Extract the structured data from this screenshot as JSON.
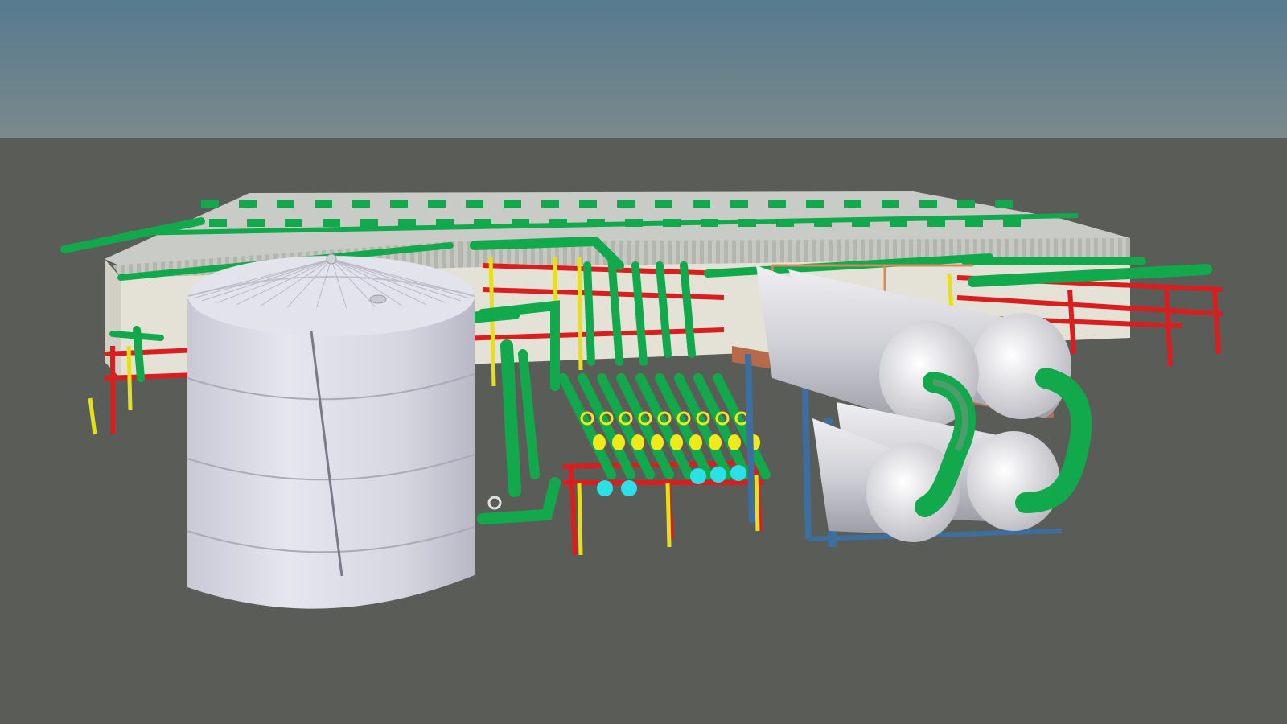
{
  "viewport": {
    "type": "3d-plant-model",
    "colors": {
      "sky_top": "#577a8e",
      "sky_bottom": "#7a898b",
      "ground": "#5a5d57",
      "building_roof": "#c9cbc6",
      "building_wall": "#e4e2d6",
      "steel_structure": "#d81e1e",
      "steel_support": "#e6e01c",
      "pipe": "#12a84c",
      "pipe_light": "#3fd27a",
      "valve": "#f0ea1a",
      "valve_cyan": "#2ce0e8",
      "tank": "#d9d9e3",
      "vessel": "#d3d3d8",
      "frame_blue": "#3c6fa0",
      "frame_brown": "#b56a4a"
    },
    "objects": {
      "tank": "storage-tank",
      "building": "process-building",
      "vessels": "horizontal-pressure-vessels",
      "pipe_rack": "pipe-rack",
      "manifold": "valve-manifold"
    }
  }
}
